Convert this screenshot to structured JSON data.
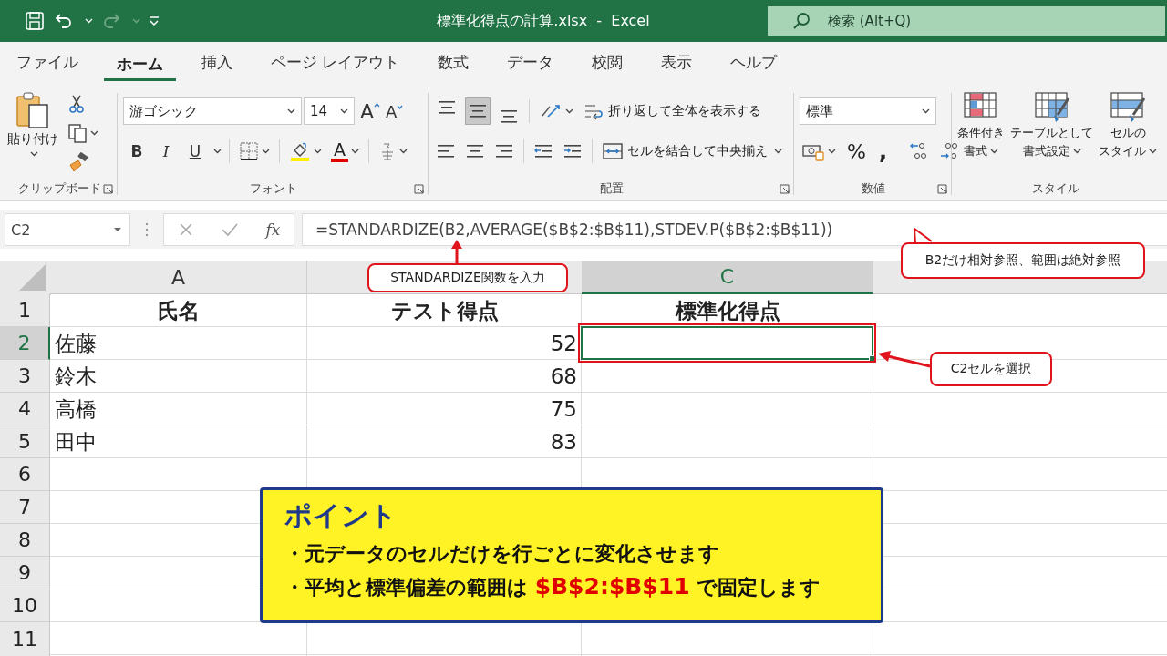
{
  "title_bar": {
    "title": "標準化得点の計算.xlsx  -  Excel",
    "search_placeholder": "検索 (Alt+Q)"
  },
  "menu_tabs": [
    {
      "label": "ファイル",
      "selected": false
    },
    {
      "label": "ホーム",
      "selected": true
    },
    {
      "label": "挿入",
      "selected": false
    },
    {
      "label": "ページ レイアウト",
      "selected": false
    },
    {
      "label": "数式",
      "selected": false
    },
    {
      "label": "データ",
      "selected": false
    },
    {
      "label": "校閲",
      "selected": false
    },
    {
      "label": "表示",
      "selected": false
    },
    {
      "label": "ヘルプ",
      "selected": false
    }
  ],
  "ribbon": {
    "clipboard": {
      "paste_label": "貼り付け",
      "group_label": "クリップボード"
    },
    "font": {
      "font_name": "游ゴシック",
      "font_size": "14",
      "grow_label": "A",
      "shrink_label": "A",
      "bold_label": "B",
      "italic_label": "I",
      "underline_label": "U",
      "font_color_label": "A",
      "group_label": "フォント"
    },
    "alignment": {
      "vertical_align": [
        {
          "selected": false
        },
        {
          "selected": true
        },
        {
          "selected": false
        }
      ],
      "wrap_text": "折り返して全体を表示する",
      "merge": "セルを結合して中央揃え",
      "group_label": "配置"
    },
    "number": {
      "format": "標準",
      "percent_label": "%",
      "comma_label": ",",
      "group_label": "数値"
    },
    "styles": {
      "buttons": [
        {
          "lines": [
            "条件付き",
            "書式"
          ]
        },
        {
          "lines": [
            "テーブルとして",
            "書式設定"
          ]
        },
        {
          "lines": [
            "セルの",
            "スタイル"
          ]
        }
      ],
      "group_label": "スタイル"
    }
  },
  "formula_bar": {
    "name_box": "C2",
    "fx_label": "fx",
    "formula": "=STANDARDIZE(B2,AVERAGE($B$2:$B$11),STDEV.P($B$2:$B$11))"
  },
  "sheet": {
    "columns": [
      {
        "label": "A",
        "selected": false
      },
      {
        "selected": false
      },
      {
        "label": "C",
        "selected": true
      },
      {
        "selected": false
      }
    ],
    "rows": [
      {
        "number": "1",
        "selected": false,
        "cells": [
          {
            "text": "氏名",
            "kind": "header"
          },
          {
            "text": "テスト得点",
            "kind": "header"
          },
          {
            "text": "標準化得点",
            "kind": "header"
          }
        ]
      },
      {
        "number": "2",
        "selected": true,
        "cells": [
          {
            "text": "佐藤",
            "kind": "text"
          },
          {
            "text": "52",
            "kind": "number"
          },
          {
            "kind": "active"
          }
        ]
      },
      {
        "number": "3",
        "selected": false,
        "cells": [
          {
            "text": "鈴木",
            "kind": "text"
          },
          {
            "text": "68",
            "kind": "number"
          }
        ]
      },
      {
        "number": "4",
        "selected": false,
        "cells": [
          {
            "text": "高橋",
            "kind": "text"
          },
          {
            "text": "75",
            "kind": "number"
          }
        ]
      },
      {
        "number": "5",
        "selected": false,
        "cells": [
          {
            "text": "田中",
            "kind": "text"
          },
          {
            "text": "83",
            "kind": "number"
          }
        ]
      },
      {
        "number": "6",
        "selected": false,
        "cells": []
      },
      {
        "number": "7",
        "selected": false,
        "cells": []
      },
      {
        "number": "8",
        "selected": false,
        "cells": []
      },
      {
        "number": "9",
        "selected": false,
        "cells": []
      },
      {
        "number": "10",
        "selected": false,
        "cells": []
      },
      {
        "number": "11",
        "selected": false,
        "cells": []
      }
    ]
  },
  "callouts": [
    {
      "text": "STANDARDIZE関数を入力",
      "kind": "formula"
    },
    {
      "text": "B2だけ相対参照、範囲は絶対参照",
      "kind": "speech"
    },
    {
      "text": "C2セルを選択",
      "kind": "cell"
    }
  ],
  "point_box": {
    "title": "ポイント",
    "lines": [
      "・元データのセルだけを行ごとに変化させます",
      "・平均と標準偏差の範囲は **$B$2:$B$11** で固定します"
    ]
  }
}
